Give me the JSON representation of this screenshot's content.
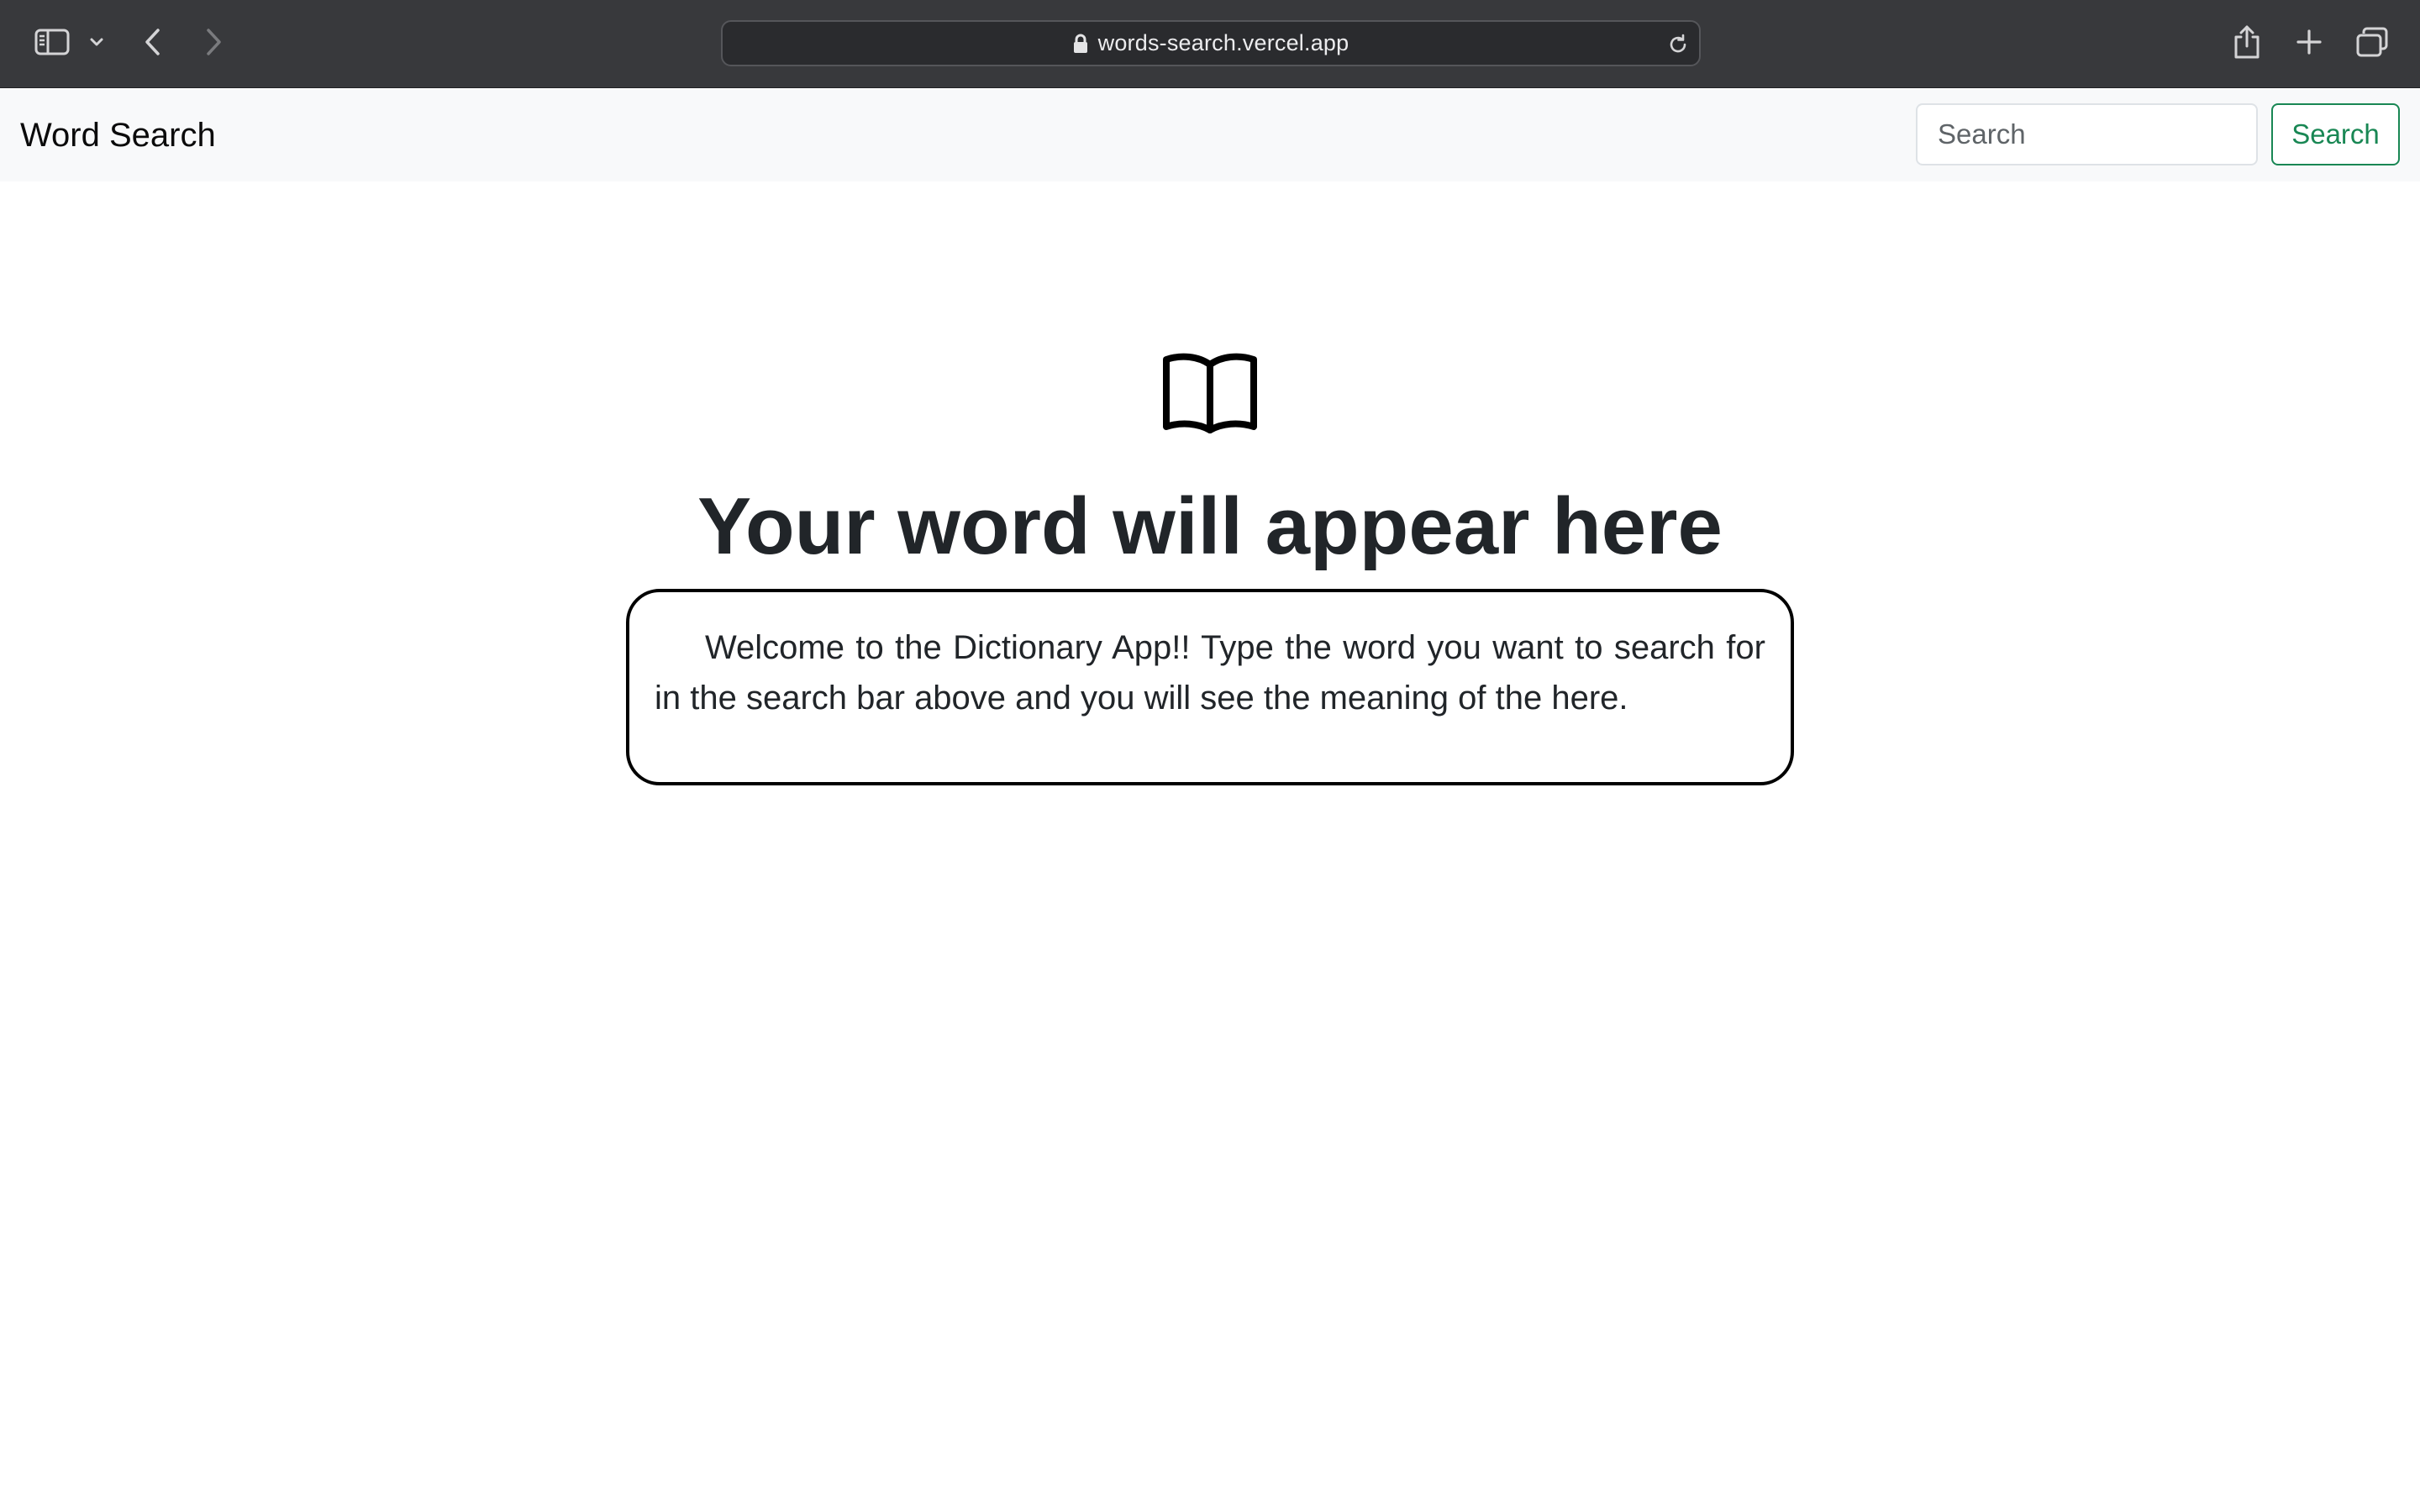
{
  "browser": {
    "url": "words-search.vercel.app",
    "icons": {
      "sidebar": "sidebar-icon",
      "sidebar_menu": "chevron-down-icon",
      "back": "chevron-left-icon",
      "forward": "chevron-right-icon",
      "lock": "lock-icon",
      "reload": "reload-icon",
      "share": "share-icon",
      "new_tab": "plus-icon",
      "tab_overview": "tabs-icon"
    }
  },
  "navbar": {
    "brand": "Word Search",
    "search_placeholder": "Search",
    "search_button_label": "Search",
    "accent_color": "#198754",
    "background_color": "#f8f9fa"
  },
  "main": {
    "icon": "book-open-icon",
    "headline": "Your word will appear here",
    "message": "Welcome to the Dictionary App!! Type the word you want to search for in the search bar above and you will see the meaning of the here."
  }
}
